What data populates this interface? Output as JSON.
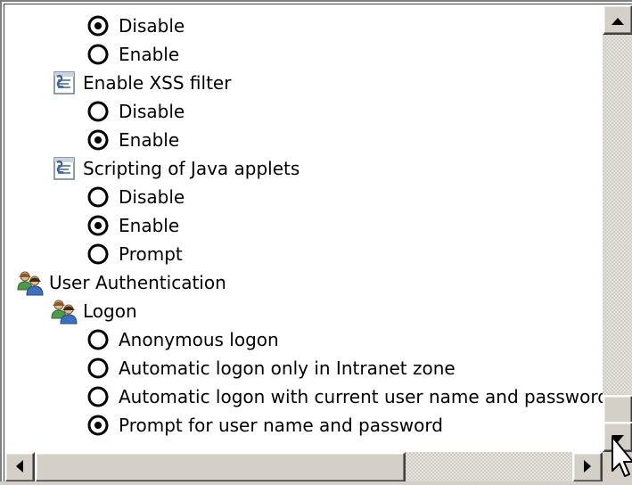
{
  "window": {
    "title": ""
  },
  "settings": {
    "item1": {
      "options": [
        {
          "label": "Disable",
          "selected": true
        },
        {
          "label": "Enable",
          "selected": false
        }
      ]
    },
    "xss": {
      "title": "Enable XSS filter",
      "icon": "script-settings-icon",
      "options": [
        {
          "label": "Disable",
          "selected": false
        },
        {
          "label": "Enable",
          "selected": true
        }
      ]
    },
    "java": {
      "title": "Scripting of Java applets",
      "icon": "script-settings-icon",
      "options": [
        {
          "label": "Disable",
          "selected": false
        },
        {
          "label": "Enable",
          "selected": true
        },
        {
          "label": "Prompt",
          "selected": false
        }
      ]
    },
    "user_auth": {
      "title": "User Authentication",
      "icon": "users-icon"
    },
    "logon": {
      "title": "Logon",
      "icon": "users-icon",
      "options": [
        {
          "label": "Anonymous logon",
          "selected": false
        },
        {
          "label": "Automatic logon only in Intranet zone",
          "selected": false
        },
        {
          "label": "Automatic logon with current user name and password",
          "selected": false
        },
        {
          "label": "Prompt for user name and password",
          "selected": true
        }
      ]
    }
  },
  "scrollbars": {
    "vertical": {
      "up_icon": "arrow-up-icon",
      "down_icon": "arrow-down-icon"
    },
    "horizontal": {
      "left_icon": "arrow-left-icon",
      "right_icon": "arrow-right-icon"
    }
  },
  "colors": {
    "face": "#d4d0c8",
    "shadow": "#404040",
    "background": "#ffffff"
  }
}
